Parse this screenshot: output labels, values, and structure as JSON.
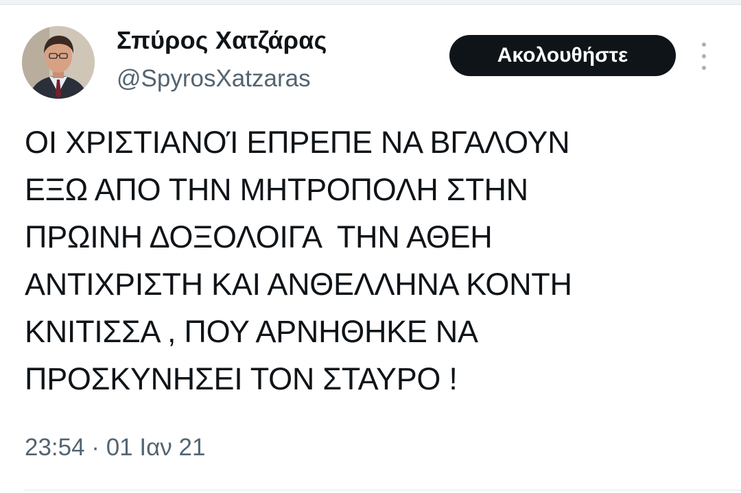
{
  "user": {
    "display_name": "Σπύρος Χατζάρας",
    "handle": "@SpyrosXatzaras",
    "avatar_icon": "profile-photo"
  },
  "actions": {
    "follow_label": "Ακολουθήστε",
    "more_icon": "vertical-ellipsis"
  },
  "tweet": {
    "lines": [
      "ΟΙ ΧΡΙΣΤΙΑΝΟΊ ΕΠΡΕΠΕ ΝΑ ΒΓΑΛΟΥΝ",
      "ΕΞΩ ΑΠΟ ΤΗΝ ΜΗΤΡΟΠΟΛΗ ΣΤΗΝ",
      "ΠΡΩΙΝΗ ΔΟΞΟΛΟΙΓΑ  ΤΗΝ ΑΘΕΗ",
      "ΑΝΤΙΧΡΙΣΤΗ ΚΑΙ ΑΝΘΕΛΛΗΝΑ ΚΟΝΤΗ",
      "ΚΝΙΤΙΣΣΑ , ΠΟΥ ΑΡΝΗΘΗΚΕ ΝΑ",
      "ΠΡΟΣΚΥΝΗΣΕΙ ΤΟΝ ΣΤΑΥΡΟ !"
    ],
    "timestamp": "23:54 · 01 Ιαν 21"
  },
  "colors": {
    "text_primary": "#0f1419",
    "text_secondary": "#536471",
    "button_bg": "#0f1419",
    "button_text": "#ffffff"
  }
}
